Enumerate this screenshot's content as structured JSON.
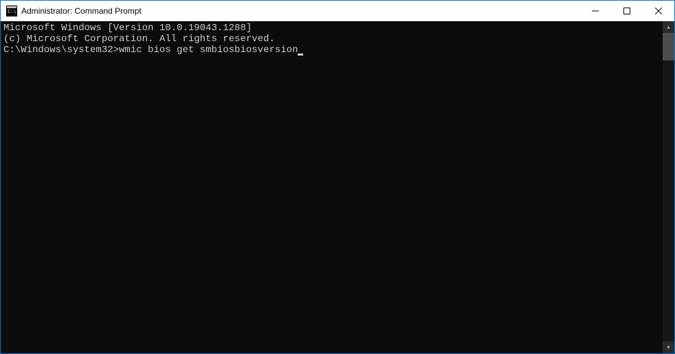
{
  "window": {
    "title": "Administrator: Command Prompt"
  },
  "terminal": {
    "lines": [
      "Microsoft Windows [Version 10.0.19043.1288]",
      "(c) Microsoft Corporation. All rights reserved.",
      ""
    ],
    "prompt": "C:\\Windows\\system32>",
    "command": "wmic bios get smbiosbiosversion"
  }
}
